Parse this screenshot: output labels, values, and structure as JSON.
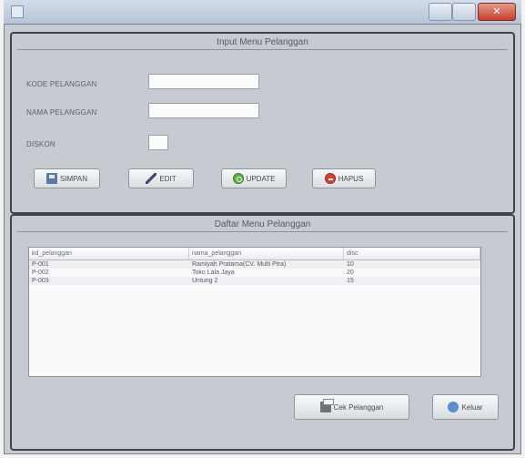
{
  "window": {
    "title": "",
    "close_label": "✕"
  },
  "input_panel": {
    "title": "Input Menu Pelanggan",
    "fields": [
      {
        "label": "KODE PELANGGAN",
        "value": ""
      },
      {
        "label": "NAMA PELANGGAN",
        "value": ""
      },
      {
        "label": "DISKON",
        "value": ""
      }
    ],
    "buttons": [
      {
        "label": "SIMPAN",
        "icon": "save-icon"
      },
      {
        "label": "EDIT",
        "icon": "edit-icon"
      },
      {
        "label": "UPDATE",
        "icon": "refresh-icon"
      },
      {
        "label": "HAPUS",
        "icon": "delete-icon"
      }
    ]
  },
  "list_panel": {
    "title": "Daftar Menu Pelanggan",
    "table": {
      "columns": [
        "kd_pelanggan",
        "nama_pelanggan",
        "disc"
      ],
      "rows": [
        [
          "P-001",
          "Ramiyah Pratama(CV. Multi Ptra)",
          "10"
        ],
        [
          "P-002",
          "Toko Lala Jaya",
          "20"
        ],
        [
          "P-003",
          "Untung 2",
          "15"
        ]
      ]
    },
    "buttons": [
      {
        "label": "Cek Pelanggan",
        "icon": "print-icon"
      },
      {
        "label": "Keluar",
        "icon": "exit-icon"
      }
    ]
  }
}
